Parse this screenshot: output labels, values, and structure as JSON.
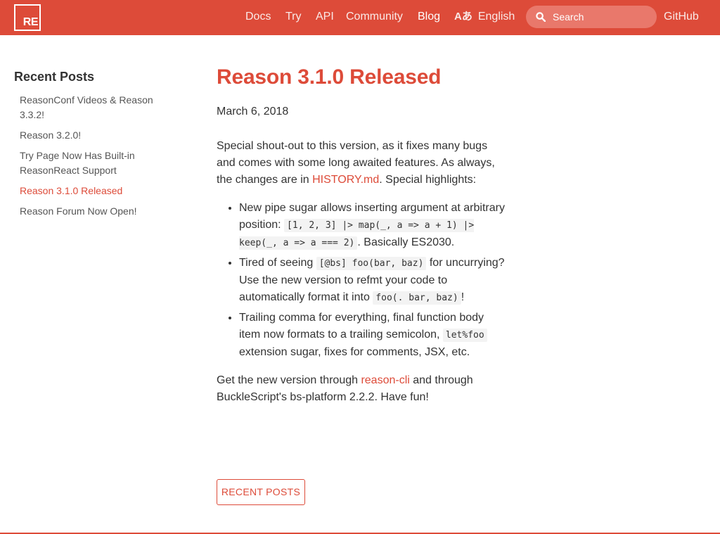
{
  "header": {
    "logo_text": "RE",
    "nav": {
      "docs": "Docs",
      "try": "Try",
      "api": "API",
      "community": "Community",
      "blog": "Blog",
      "language": "English",
      "github": "GitHub"
    },
    "language_icon": "translate-icon",
    "search": {
      "placeholder": "Search",
      "value": ""
    }
  },
  "sidebar": {
    "title": "Recent Posts",
    "items": [
      {
        "label": "ReasonConf Videos & Reason 3.3.2!",
        "current": false
      },
      {
        "label": "Reason 3.2.0!",
        "current": false
      },
      {
        "label": "Try Page Now Has Built-in ReasonReact Support",
        "current": false
      },
      {
        "label": "Reason 3.1.0 Released",
        "current": true
      },
      {
        "label": "Reason Forum Now Open!",
        "current": false
      }
    ]
  },
  "post": {
    "title": "Reason 3.1.0 Released",
    "date": "March 6, 2018",
    "intro": {
      "before": "Special shout-out to this version, as it fixes many bugs and comes with some long awaited features. As always, the changes are in ",
      "link": "HISTORY.md",
      "after": ". Special highlights:"
    },
    "highlights": [
      {
        "text1": "New pipe sugar allows inserting argument at arbitrary position: ",
        "code1": "[1, 2, 3] |> map(_, a => a + 1) |> keep(_, a => a === 2)",
        "text2": ". Basically ES2030."
      },
      {
        "text1": "Tired of seeing ",
        "code1": "[@bs] foo(bar, baz)",
        "text2": " for uncurrying? Use the new version to refmt your code to automatically format it into ",
        "code2": "foo(. bar, baz)",
        "text3": "!"
      },
      {
        "text1": "Trailing comma for everything, final function body item now formats to a trailing semicolon, ",
        "code1": "let%foo",
        "text2": " extension sugar, fixes for comments, JSX, etc."
      }
    ],
    "outro": {
      "before": "Get the new version through ",
      "link": "reason-cli",
      "after": " and through BuckleScript's bs-platform 2.2.2. Have fun!"
    },
    "recent_posts_button": "RECENT POSTS"
  },
  "colors": {
    "brand": "#dd4b39",
    "text": "#333333",
    "code_bg": "#f3f3f3"
  }
}
